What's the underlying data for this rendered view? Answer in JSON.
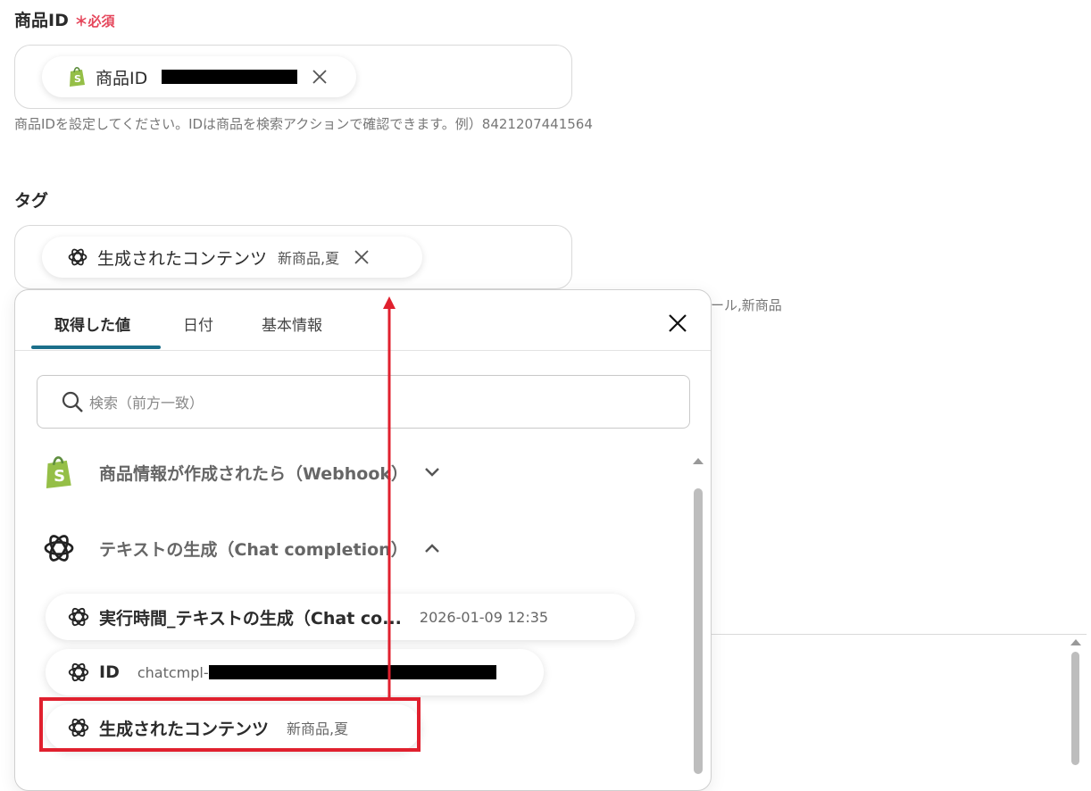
{
  "product_id_field": {
    "label": "商品ID",
    "required_mark": "＊必須",
    "chip_label": "商品ID",
    "help": "商品IDを設定してください。IDは商品を検索アクションで確認できます。例）8421207441564"
  },
  "tag_field": {
    "label": "タグ",
    "chip_label": "生成されたコンテンツ",
    "chip_value": "新商品,夏",
    "help_partial": "ール,新商品"
  },
  "picker": {
    "tabs": [
      "取得した値",
      "日付",
      "基本情報"
    ],
    "search_placeholder": "検索（前方一致）",
    "groups": [
      {
        "label": "商品情報が作成されたら（Webhook）",
        "icon": "shopify-icon"
      },
      {
        "label": "テキストの生成（Chat completion）",
        "icon": "openai-icon"
      }
    ],
    "items": [
      {
        "name": "実行時間_テキストの生成（Chat co...",
        "value": "2026-01-09 12:35"
      },
      {
        "name": "ID",
        "value": "chatcmpl-"
      },
      {
        "name": "生成されたコンテンツ",
        "value": "新商品,夏"
      }
    ]
  },
  "colors": {
    "accent_tab": "#1b6f8a",
    "required": "#e5455a",
    "highlight": "#e0202e",
    "shopify_green": "#95bf47"
  }
}
